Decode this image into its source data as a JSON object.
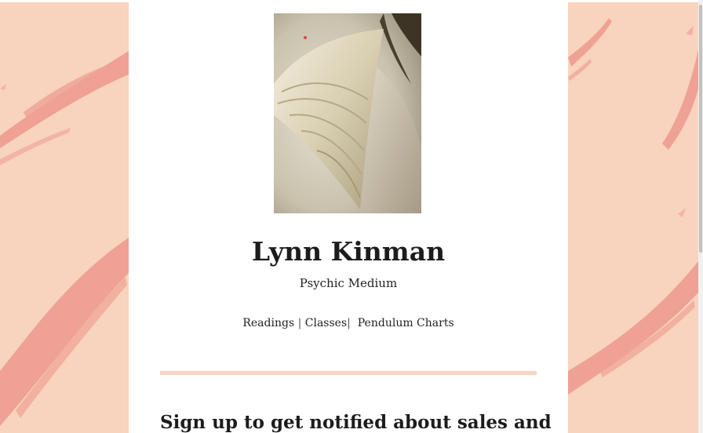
{
  "site": {
    "name": "Lynn Kinman",
    "tagline": "Psychic Medium"
  },
  "nav": {
    "items": [
      {
        "label": "Readings"
      },
      {
        "label": "Classes"
      },
      {
        "label": "Pendulum Charts"
      }
    ],
    "separator": "|"
  },
  "signup": {
    "heading": "Sign up to get notified about sales and"
  },
  "hero_image": {
    "subject": "angel-wing-photo"
  },
  "colors": {
    "background": "#f8d3bd",
    "brush_stroke": "#eea194",
    "card": "#ffffff",
    "text": "#1c1c1c",
    "divider": "#f8d3bd"
  }
}
